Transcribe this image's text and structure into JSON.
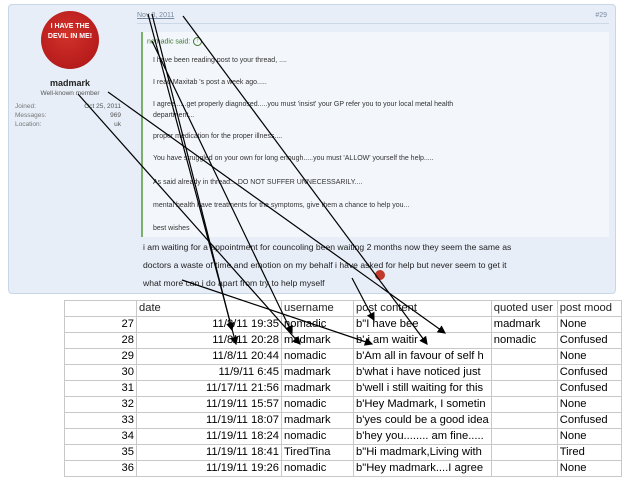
{
  "post": {
    "avatar_line1": "I HAVE THE",
    "avatar_line2": "DEVIL IN ME!",
    "username": "madmark",
    "user_title": "Well-known member",
    "stats": [
      {
        "label": "Joined:",
        "value": "Oct 25, 2011"
      },
      {
        "label": "Messages:",
        "value": "969"
      },
      {
        "label": "Location:",
        "value": "uk"
      }
    ],
    "date": "Nov 8, 2011",
    "post_number": "#29",
    "quote": {
      "author": "nomadic said:",
      "lines": [
        "I have been reading post to your thread, ....",
        "I read Maxitab 's post a week ago.....",
        "I agree......get properly diagnosed.....you must 'insist' your GP refer you to your local metal health",
        "department...",
        "proper medication for the proper illness....",
        "You have struggled on your own for long enough.....you must 'ALLOW' yourself the help.....",
        "As said already in thread....DO NOT SUFFER UNNECESSARILY....",
        "mental health have treatments for the symptoms, give them a chance to help you...",
        "best wishes"
      ]
    },
    "reply_lines": [
      "i am waiting for a appointment for councoling been waiting 2 months now they seem the same as",
      "doctors a waste of time and emotion on my behalf i have asked for help but never seem to get it",
      "what more can i do apart from try to help myself"
    ]
  },
  "table": {
    "headers": [
      "",
      "date",
      "username",
      "post content",
      "quoted user",
      "post mood"
    ],
    "rows": [
      [
        "27",
        "11/8/11 19:35",
        "nomadic",
        "b\"I have bee",
        "madmark",
        "None"
      ],
      [
        "28",
        "11/8/11 20:28",
        "madmark",
        "b' i am waitir",
        "nomadic",
        "Confused"
      ],
      [
        "29",
        "11/8/11 20:44",
        "nomadic",
        "b'Am all in favour of self h",
        "",
        "None"
      ],
      [
        "30",
        "11/9/11 6:45",
        "madmark",
        "b'what i have noticed just",
        "",
        "Confused"
      ],
      [
        "31",
        "11/17/11 21:56",
        "madmark",
        "b'well i still waiting for this",
        "",
        "Confused"
      ],
      [
        "32",
        "11/19/11 15:57",
        "nomadic",
        "b'Hey Madmark, I sometin",
        "",
        "None"
      ],
      [
        "33",
        "11/19/11 18:07",
        "madmark",
        "b'yes could be a good idea",
        "",
        "Confused"
      ],
      [
        "34",
        "11/19/11 18:24",
        "nomadic",
        "b'hey you........ am fine.....",
        "",
        "None"
      ],
      [
        "35",
        "11/19/11 18:41",
        "TiredTina",
        "b\"Hi madmark,Living with",
        "",
        "Tired"
      ],
      [
        "36",
        "11/19/11 19:26",
        "nomadic",
        "b\"Hey madmark....I agree",
        "",
        "None"
      ]
    ]
  },
  "colors": {
    "post_bg": "#e7eef8",
    "quote_border": "#7ab06b",
    "avatar": "#b71c1c",
    "arrow": "#000000"
  }
}
